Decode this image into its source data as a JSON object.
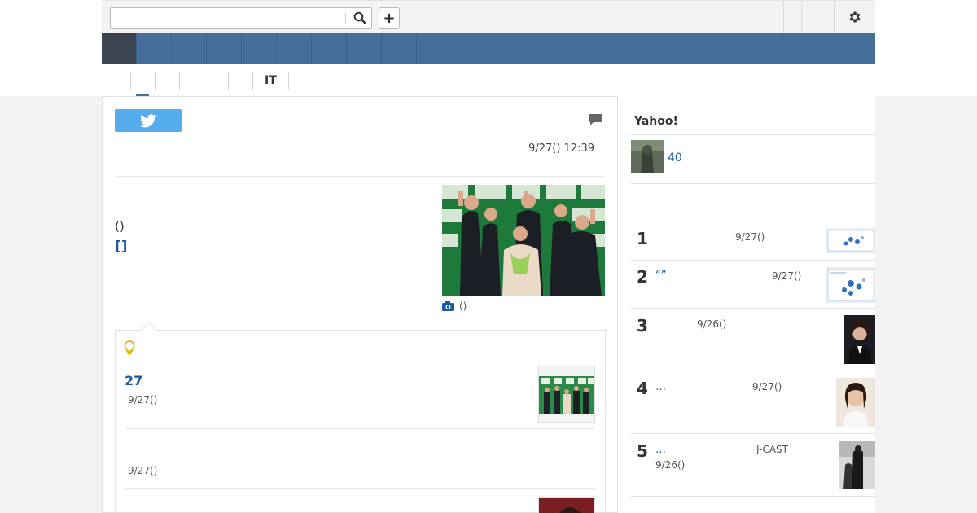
{
  "header": {
    "search_placeholder": "",
    "plus_label": "+"
  },
  "nav": {
    "item_count": 9,
    "active_index": 0
  },
  "subnav": {
    "items": [
      "",
      "",
      "",
      "",
      "",
      "IT",
      "",
      ""
    ],
    "active_index": 0
  },
  "article": {
    "date": "9/27() 12:39",
    "paren_text": "()",
    "bracket_text": "[]",
    "photo_caption": "()"
  },
  "related": {
    "items": [
      {
        "title": "27",
        "date": "9/27()"
      },
      {
        "title": "",
        "date": "9/27()"
      }
    ]
  },
  "sidebar": {
    "title": "Yahoo!",
    "count": "40",
    "ranking": [
      {
        "num": "1",
        "title": "",
        "source": "",
        "date": "9/27()"
      },
      {
        "num": "2",
        "title": "“”",
        "source": "",
        "date": "9/27()"
      },
      {
        "num": "3",
        "title": "",
        "source": "",
        "date": "9/26()"
      },
      {
        "num": "4",
        "title": "…",
        "source": "",
        "date": "9/27()"
      },
      {
        "num": "5",
        "title": "…",
        "source": "J-CAST",
        "date": "9/26()"
      }
    ]
  },
  "colors": {
    "nav": "#456f9a",
    "nav_active": "#3c4653",
    "link": "#1a5aa0",
    "twitter": "#55acee"
  }
}
